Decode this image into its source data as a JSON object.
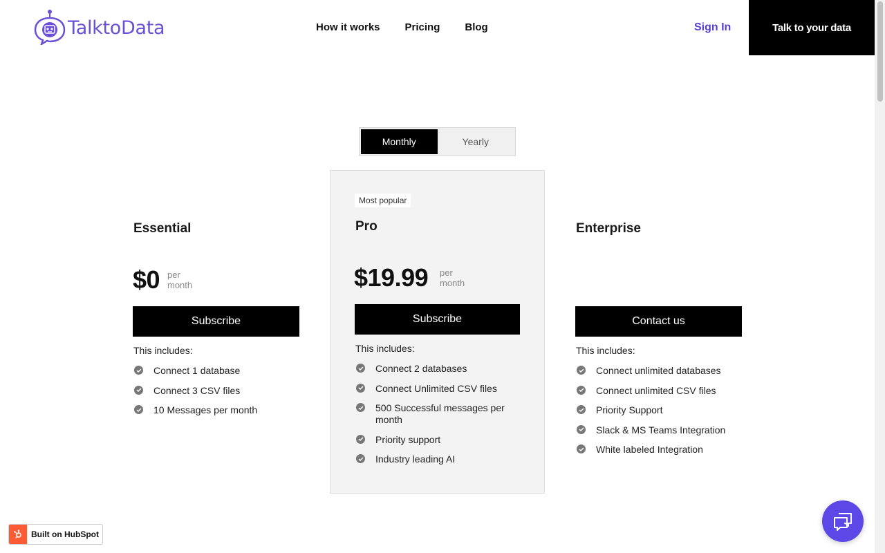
{
  "brand": {
    "name": "TalktoData",
    "color": "#6b4fd8"
  },
  "nav": {
    "items": [
      "How it works",
      "Pricing",
      "Blog"
    ],
    "sign_in": "Sign In",
    "cta": "Talk to your data"
  },
  "billing_toggle": {
    "options": [
      "Monthly",
      "Yearly"
    ],
    "selected": "Monthly"
  },
  "plans": [
    {
      "name": "Essential",
      "price": "$0",
      "per": [
        "per",
        "month"
      ],
      "button": "Subscribe",
      "includes": "This includes:",
      "features": [
        "Connect 1 database",
        "Connect 3 CSV files",
        "10 Messages per month"
      ]
    },
    {
      "badge": "Most popular",
      "name": "Pro",
      "price": "$19.99",
      "per": [
        "per",
        "month"
      ],
      "button": "Subscribe",
      "includes": "This includes:",
      "features": [
        "Connect 2 databases",
        "Connect Unlimited CSV files",
        "500 Successful messages per month",
        "Priority support",
        "Industry leading AI"
      ]
    },
    {
      "name": "Enterprise",
      "button": "Contact us",
      "includes": "This includes:",
      "features": [
        "Connect unlimited databases",
        "Connect unlimited CSV files",
        "Priority Support",
        "Slack & MS Teams Integration",
        "White labeled Integration"
      ]
    }
  ],
  "hubspot_badge": "Built on HubSpot",
  "colors": {
    "accent": "#5a3fd6",
    "chat": "#5b48e6",
    "hubspot": "#ff5c35"
  }
}
